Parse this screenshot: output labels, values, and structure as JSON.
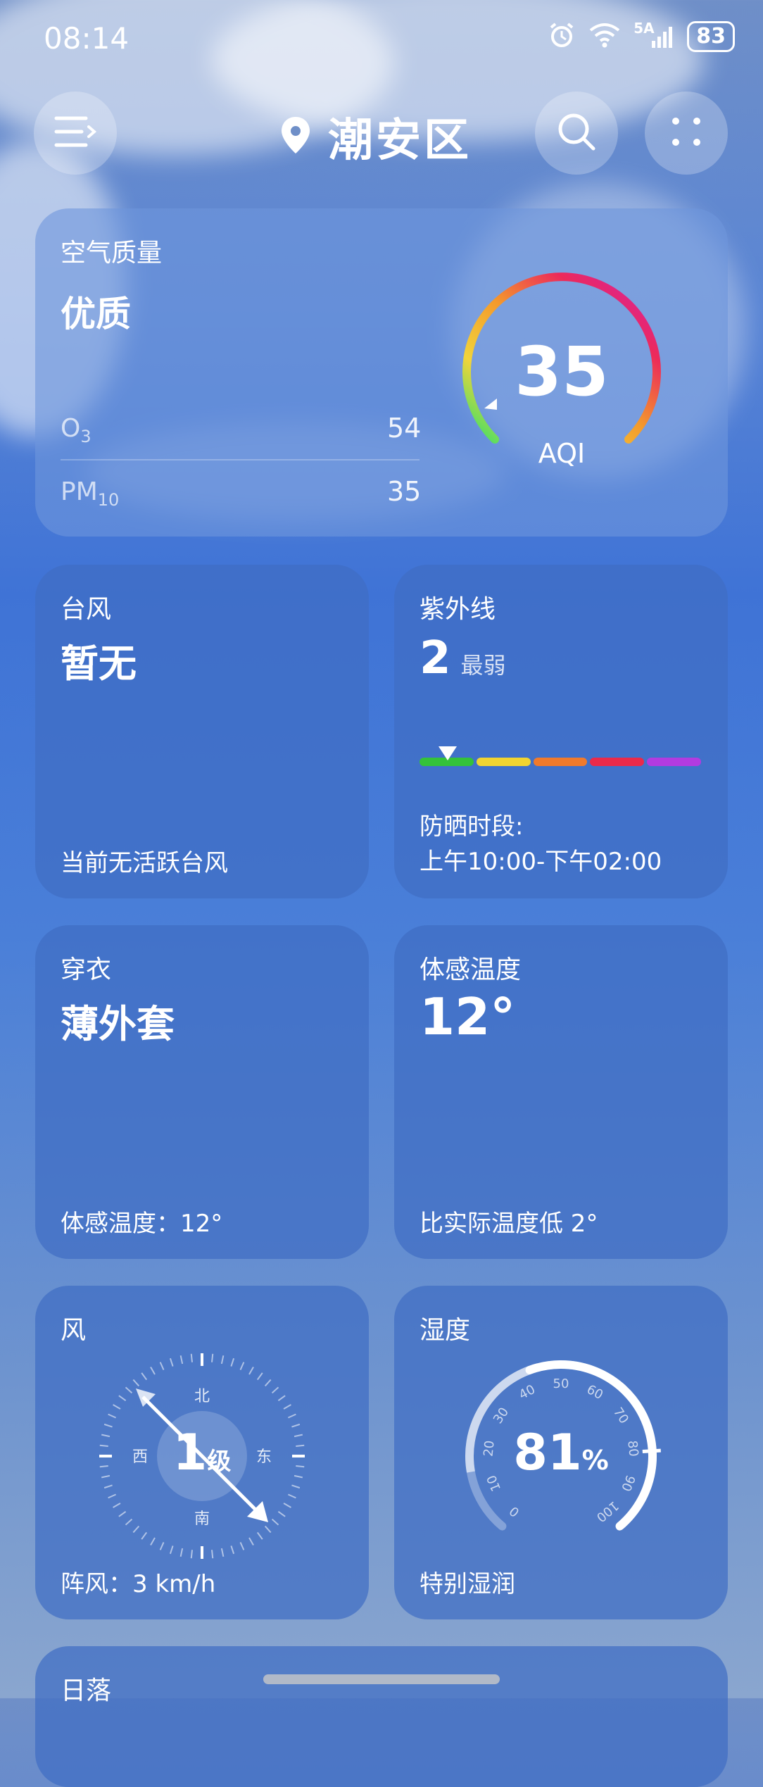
{
  "status": {
    "time": "08:14",
    "signal": "5A",
    "battery": "83"
  },
  "header": {
    "location": "潮安区",
    "menu_icon": "menu-icon",
    "search_icon": "search-icon",
    "more_icon": "grid-dots-icon"
  },
  "air": {
    "title": "空气质量",
    "level": "优质",
    "rows": [
      {
        "label_main": "O",
        "label_sub": "3",
        "value": "54"
      },
      {
        "label_main": "PM",
        "label_sub": "10",
        "value": "35"
      }
    ],
    "aqi": "35",
    "aqi_label": "AQI"
  },
  "typhoon": {
    "title": "台风",
    "status": "暂无",
    "note": "当前无活跃台风"
  },
  "uv": {
    "title": "紫外线",
    "index": "2",
    "level": "最弱",
    "marker_fraction": 0.1,
    "protect_label": "防晒时段:",
    "protect_time": "上午10:00-下午02:00",
    "colors": [
      "#34c23a",
      "#f1d431",
      "#f07a2c",
      "#ea2a4a",
      "#b23be0"
    ]
  },
  "clothing": {
    "title": "穿衣",
    "value": "薄外套",
    "note": "体感温度：12°"
  },
  "feels": {
    "title": "体感温度",
    "value": "12°",
    "note": "比实际温度低 2°"
  },
  "wind": {
    "title": "风",
    "level": "1",
    "level_unit": "级",
    "dirs": {
      "n": "北",
      "s": "南",
      "e": "东",
      "w": "西"
    },
    "gust": "阵风：3 km/h"
  },
  "humidity": {
    "title": "湿度",
    "value": "81",
    "unit": "%",
    "note": "特别湿润",
    "ticks": [
      "0",
      "10",
      "20",
      "30",
      "40",
      "50",
      "60",
      "70",
      "80",
      "90",
      "100"
    ],
    "fraction": 0.81
  },
  "sunset": {
    "title": "日落"
  }
}
